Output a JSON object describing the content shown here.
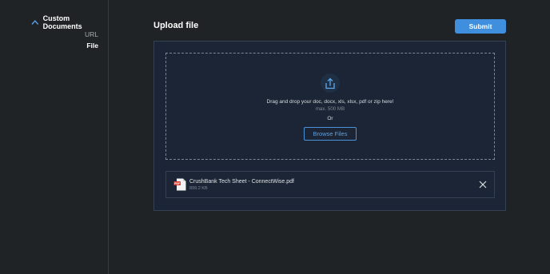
{
  "sidebar": {
    "section_title": "Custom Documents",
    "items": [
      {
        "label": "URL",
        "active": false
      },
      {
        "label": "File",
        "active": true
      }
    ],
    "toggle_icon": "chevron-up-icon"
  },
  "header": {
    "title": "Upload file",
    "submit_label": "Submit"
  },
  "upload": {
    "icon": "upload-icon",
    "instruction": "Drag and drop your doc, docx, xls, xlsx, pdf or zip here!",
    "max_size": "max. 500 MB",
    "or_text": "Or",
    "browse_label": "Browse Files"
  },
  "files": [
    {
      "icon": "pdf-file-icon",
      "name": "CrushBank Tech Sheet - ConnectWise.pdf",
      "size": "899.2 KB",
      "remove_icon": "close-icon"
    }
  ],
  "colors": {
    "background": "#1f2326",
    "panel": "#1b2535",
    "accent": "#3f8fde",
    "link": "#59a2ea"
  }
}
